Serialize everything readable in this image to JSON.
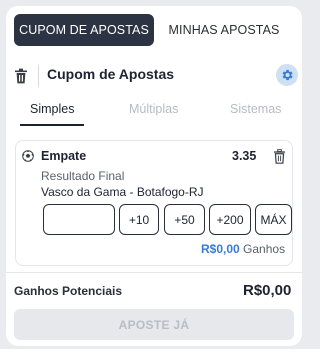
{
  "top_tabs": [
    {
      "label": "CUPOM DE APOSTAS"
    },
    {
      "label": "MINHAS APOSTAS"
    }
  ],
  "slip": {
    "title": "Cupom de Apostas"
  },
  "sub_tabs": [
    {
      "label": "Simples"
    },
    {
      "label": "Múltiplas"
    },
    {
      "label": "Sistemas"
    }
  ],
  "bet": {
    "selection": "Empate",
    "odd": "3.35",
    "market": "Resultado Final",
    "match": "Vasco da Gama - Botafogo-RJ",
    "stake_value": "",
    "quick_stakes": [
      "+10",
      "+50",
      "+200",
      "MÁX"
    ],
    "gains_amount": "R$0,00",
    "gains_label": "Ganhos"
  },
  "footer": {
    "potential_label": "Ganhos Potenciais",
    "potential_value": "R$0,00",
    "submit_label": "APOSTE JÁ"
  },
  "colors": {
    "active_tab_bg": "#2c3443",
    "accent_blue": "#3a7bd5",
    "gear_bg": "#cfe0f4"
  }
}
